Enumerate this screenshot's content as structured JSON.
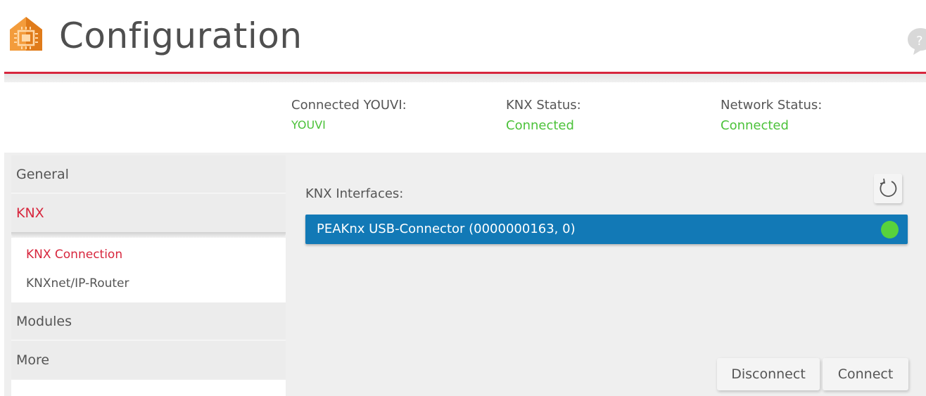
{
  "header": {
    "title": "Configuration",
    "logo": "house-chip-logo-icon",
    "help_icon": "help-bubble-icon"
  },
  "status": {
    "youvi": {
      "label": "Connected YOUVI:",
      "value": "YOUVI"
    },
    "knx": {
      "label": "KNX Status:",
      "value": "Connected"
    },
    "network": {
      "label": "Network Status:",
      "value": "Connected"
    }
  },
  "sidebar": {
    "items": [
      {
        "label": "General"
      },
      {
        "label": "KNX",
        "active": true
      },
      {
        "label": "Modules"
      },
      {
        "label": "More"
      }
    ],
    "sub_items": [
      {
        "label": "KNX Connection",
        "active": true
      },
      {
        "label": "KNXnet/IP-Router"
      }
    ]
  },
  "content": {
    "interfaces_label": "KNX Interfaces:",
    "refresh_icon": "refresh-icon",
    "interfaces": [
      {
        "name": "PEAKnx USB-Connector (0000000163, 0)",
        "status": "connected"
      }
    ],
    "buttons": {
      "disconnect": "Disconnect",
      "connect": "Connect"
    }
  },
  "colors": {
    "accent_red": "#d7263d",
    "status_green": "#4cc23a",
    "selection_blue": "#1279b6",
    "indicator_green": "#58d23c"
  }
}
